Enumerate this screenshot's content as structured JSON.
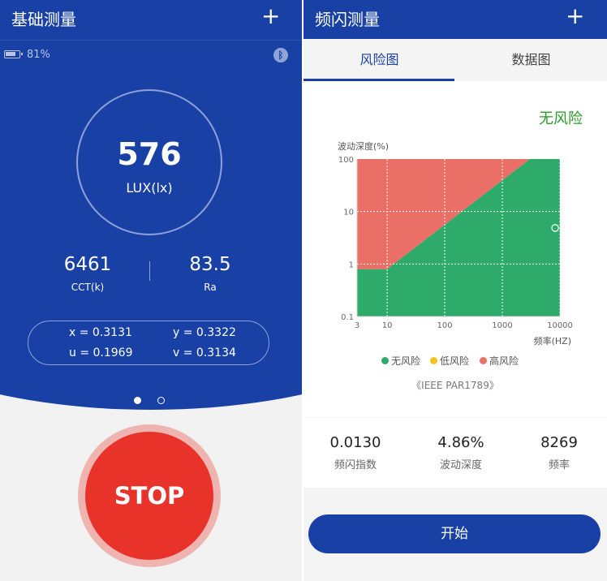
{
  "left": {
    "header": {
      "title": "基础测量",
      "plus": "+"
    },
    "status": {
      "battery_level": 0.81,
      "battery_text": "81%",
      "bluetooth_glyph": "ᛒ"
    },
    "lux": {
      "value": "576",
      "unit": "LUX(lx)"
    },
    "cct": {
      "value": "6461",
      "label": "CCT(k)"
    },
    "ra": {
      "value": "83.5",
      "label": "Ra"
    },
    "coords": {
      "x": "x = 0.3131",
      "y": "y = 0.3322",
      "u": "u = 0.1969",
      "v": "v = 0.3134"
    },
    "pager": {
      "count": 2,
      "active": 0
    },
    "stop_label": "STOP"
  },
  "right": {
    "header": {
      "title": "频闪测量",
      "plus": "+"
    },
    "tabs": [
      {
        "label": "风险图",
        "active": true
      },
      {
        "label": "数据图",
        "active": false
      }
    ],
    "risk_status": "无风险",
    "legend": [
      {
        "label": "无风险",
        "color": "#2eaa6b"
      },
      {
        "label": "低风险",
        "color": "#f6c21f"
      },
      {
        "label": "高风险",
        "color": "#ea6f66"
      }
    ],
    "standard": "《IEEE PAR1789》",
    "stats": [
      {
        "value": "0.0130",
        "label": "频闪指数"
      },
      {
        "value": "4.86%",
        "label": "波动深度"
      },
      {
        "value": "8269",
        "label": "频率"
      }
    ],
    "start_label": "开始"
  },
  "chart_data": {
    "type": "area",
    "x_scale": "log",
    "y_scale": "log",
    "xlabel": "频率(HZ)",
    "ylabel": "波动深度(%)",
    "xlim": [
      3,
      10000
    ],
    "ylim": [
      0.1,
      100
    ],
    "x_ticks": [
      3,
      10,
      100,
      1000,
      10000
    ],
    "y_ticks": [
      0.1,
      1,
      10,
      100
    ],
    "grid": true,
    "legend_position": "bottom",
    "boundaries": [
      {
        "name": "低风险",
        "points": [
          [
            3,
            0.8
          ],
          [
            10,
            0.8
          ],
          [
            3000,
            100
          ]
        ]
      },
      {
        "name": "高风险",
        "points": [
          [
            3,
            0.8
          ],
          [
            10,
            0.8
          ],
          [
            3000,
            100
          ]
        ]
      }
    ],
    "regions": [
      {
        "name": "无风险",
        "color": "#2eaa6b"
      },
      {
        "name": "低风险",
        "color": "#f6c21f"
      },
      {
        "name": "高风险",
        "color": "#ea6f66"
      }
    ],
    "measurement": {
      "x": 8269,
      "y": 4.86
    }
  }
}
